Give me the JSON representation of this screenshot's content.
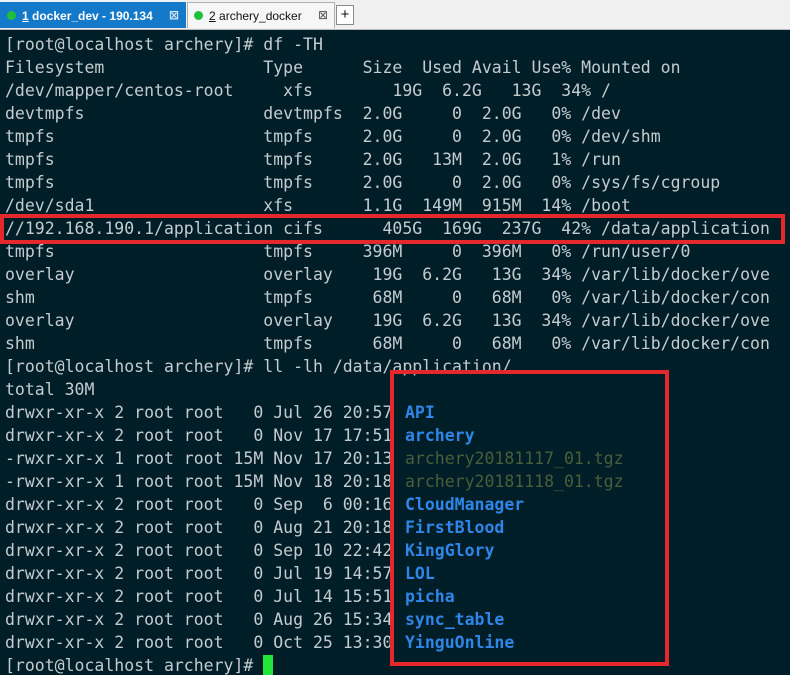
{
  "tabs": [
    {
      "number": "1",
      "title": " docker_dev - 190.134",
      "close": "⊠",
      "state": "active",
      "status_color": "#1fbf3a"
    },
    {
      "number": "2",
      "title": " archery_docker",
      "close": "⊠",
      "state": "inactive",
      "status_color": "#1fbf3a"
    }
  ],
  "add_tab_label": "+",
  "prompt": "[root@localhost archery]# ",
  "commands": {
    "df": "df -TH",
    "ll": "ll -lh /data/application/"
  },
  "df_header": "Filesystem                Type      Size  Used Avail Use% Mounted on",
  "df_rows": [
    "/dev/mapper/centos-root     xfs        19G  6.2G   13G  34% /",
    "devtmpfs                  devtmpfs  2.0G     0  2.0G   0% /dev",
    "tmpfs                     tmpfs     2.0G     0  2.0G   0% /dev/shm",
    "tmpfs                     tmpfs     2.0G   13M  2.0G   1% /run",
    "tmpfs                     tmpfs     2.0G     0  2.0G   0% /sys/fs/cgroup",
    "/dev/sda1                 xfs       1.1G  149M  915M  14% /boot",
    "//192.168.190.1/application cifs      405G  169G  237G  42% /data/application",
    "tmpfs                     tmpfs     396M     0  396M   0% /run/user/0",
    "overlay                   overlay    19G  6.2G   13G  34% /var/lib/docker/ove",
    "shm                       tmpfs      68M     0   68M   0% /var/lib/docker/con",
    "overlay                   overlay    19G  6.2G   13G  34% /var/lib/docker/ove",
    "shm                       tmpfs      68M     0   68M   0% /var/lib/docker/con"
  ],
  "ll_total": "total 30M",
  "ll_rows": [
    {
      "meta": "drwxr-xr-x 2 root root   0 Jul 26 20:57",
      "name": "API",
      "kind": "dir"
    },
    {
      "meta": "drwxr-xr-x 2 root root   0 Nov 17 17:51",
      "name": "archery",
      "kind": "dir"
    },
    {
      "meta": "-rwxr-xr-x 1 root root 15M Nov 17 20:13",
      "name": "archery20181117_01.tgz",
      "kind": "tgz"
    },
    {
      "meta": "-rwxr-xr-x 1 root root 15M Nov 18 20:18",
      "name": "archery20181118_01.tgz",
      "kind": "tgz"
    },
    {
      "meta": "drwxr-xr-x 2 root root   0 Sep  6 00:16",
      "name": "CloudManager",
      "kind": "dir"
    },
    {
      "meta": "drwxr-xr-x 2 root root   0 Aug 21 20:18",
      "name": "FirstBlood",
      "kind": "dir"
    },
    {
      "meta": "drwxr-xr-x 2 root root   0 Sep 10 22:42",
      "name": "KingGlory",
      "kind": "dir"
    },
    {
      "meta": "drwxr-xr-x 2 root root   0 Jul 19 14:57",
      "name": "LOL",
      "kind": "dir"
    },
    {
      "meta": "drwxr-xr-x 2 root root   0 Jul 14 15:51",
      "name": "picha",
      "kind": "dir"
    },
    {
      "meta": "drwxr-xr-x 2 root root   0 Aug 26 15:34",
      "name": "sync_table",
      "kind": "dir"
    },
    {
      "meta": "drwxr-xr-x 2 root root   0 Oct 25 13:30",
      "name": "YinguOnline",
      "kind": "dir"
    }
  ],
  "colors": {
    "background": "#001e27",
    "text": "#c4ccd0",
    "directory": "#2f86e8",
    "archive": "#4a5e3a",
    "highlight": "#e5282c",
    "cursor": "#22e33a",
    "active_tab": "#1579c9"
  }
}
